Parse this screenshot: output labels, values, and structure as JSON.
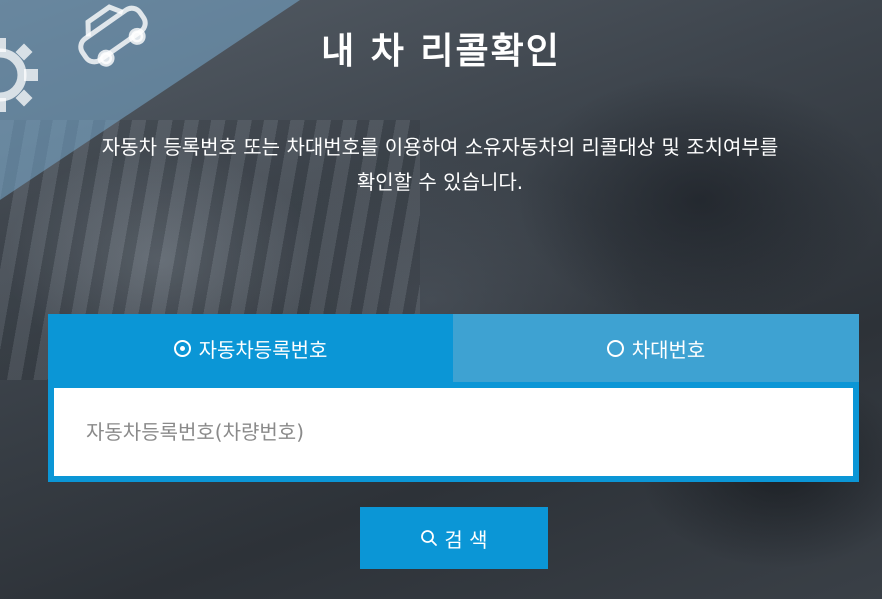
{
  "page": {
    "title": "내 차 리콜확인",
    "description_line1": "자동차 등록번호 또는 차대번호를 이용하여 소유자동차의 리콜대상 및 조치여부를",
    "description_line2": "확인할 수 있습니다."
  },
  "tabs": [
    {
      "label": "자동차등록번호",
      "selected": true
    },
    {
      "label": "차대번호",
      "selected": false
    }
  ],
  "search": {
    "placeholder": "자동차등록번호(차량번호)",
    "value": "",
    "button_label": "검 색"
  },
  "colors": {
    "accent": "#0b96d6",
    "accent_inactive": "#3ea2d2"
  }
}
